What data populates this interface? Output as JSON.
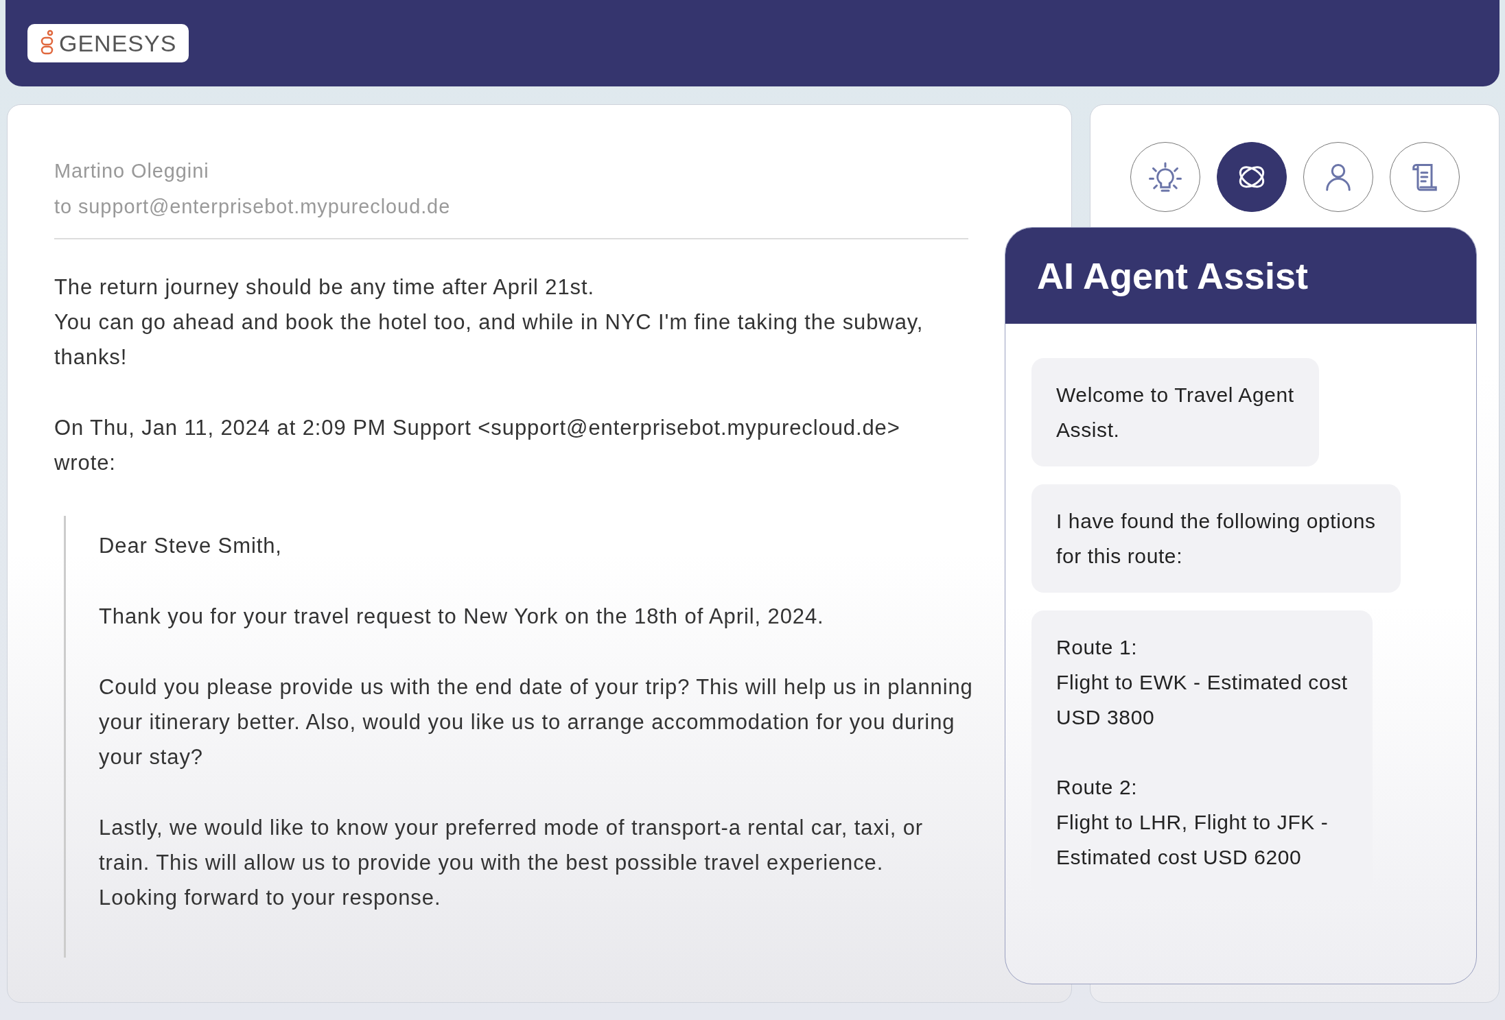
{
  "header": {
    "logo": "GENESYS"
  },
  "email": {
    "sender": "Martino Oleggini",
    "recipient": "to support@enterprisebot.mypurecloud.de",
    "paragraphs": [
      {
        "lines": [
          "The return journey should be any time after April 21st.",
          "You can go ahead and book the hotel too, and while in NYC I'm fine taking the subway,",
          "thanks!"
        ]
      },
      {
        "lines": [
          "On Thu, Jan 11, 2024 at 2:09 PM Support <support@enterprisebot.mypurecloud.de>",
          "wrote:"
        ]
      }
    ],
    "quote": [
      {
        "lines": [
          "Dear Steve Smith,"
        ]
      },
      {
        "lines": [
          "Thank you for your travel request to New York on the 18th of April, 2024."
        ]
      },
      {
        "lines": [
          "Could you please provide us with the end date of your trip? This will help us in planning",
          "your itinerary better. Also, would you like us to arrange accommodation for you during",
          "your stay?"
        ]
      },
      {
        "lines": [
          "Lastly, we would like to know your preferred mode of transport-a rental car, taxi, or",
          "train. This will allow us to provide you with the best possible travel experience.",
          "Looking forward to your response."
        ]
      }
    ]
  },
  "tools": [
    {
      "kind": "lightbulb",
      "selected": false
    },
    {
      "kind": "orbit",
      "selected": true
    },
    {
      "kind": "person",
      "selected": false
    },
    {
      "kind": "scroll",
      "selected": false
    }
  ],
  "assist": {
    "title": "AI Agent Assist",
    "messages": [
      {
        "paragraphs": [
          {
            "lines": [
              "Welcome to Travel Agent",
              "Assist."
            ]
          }
        ]
      },
      {
        "paragraphs": [
          {
            "lines": [
              "I have found the following options",
              "for this route:"
            ]
          }
        ]
      },
      {
        "paragraphs": [
          {
            "lines": [
              "Route 1:",
              "Flight to EWK - Estimated cost",
              "USD 3800"
            ]
          },
          {
            "lines": [
              "Route 2:",
              "Flight to LHR, Flight to JFK -",
              "Estimated cost USD 6200"
            ]
          }
        ]
      }
    ]
  }
}
